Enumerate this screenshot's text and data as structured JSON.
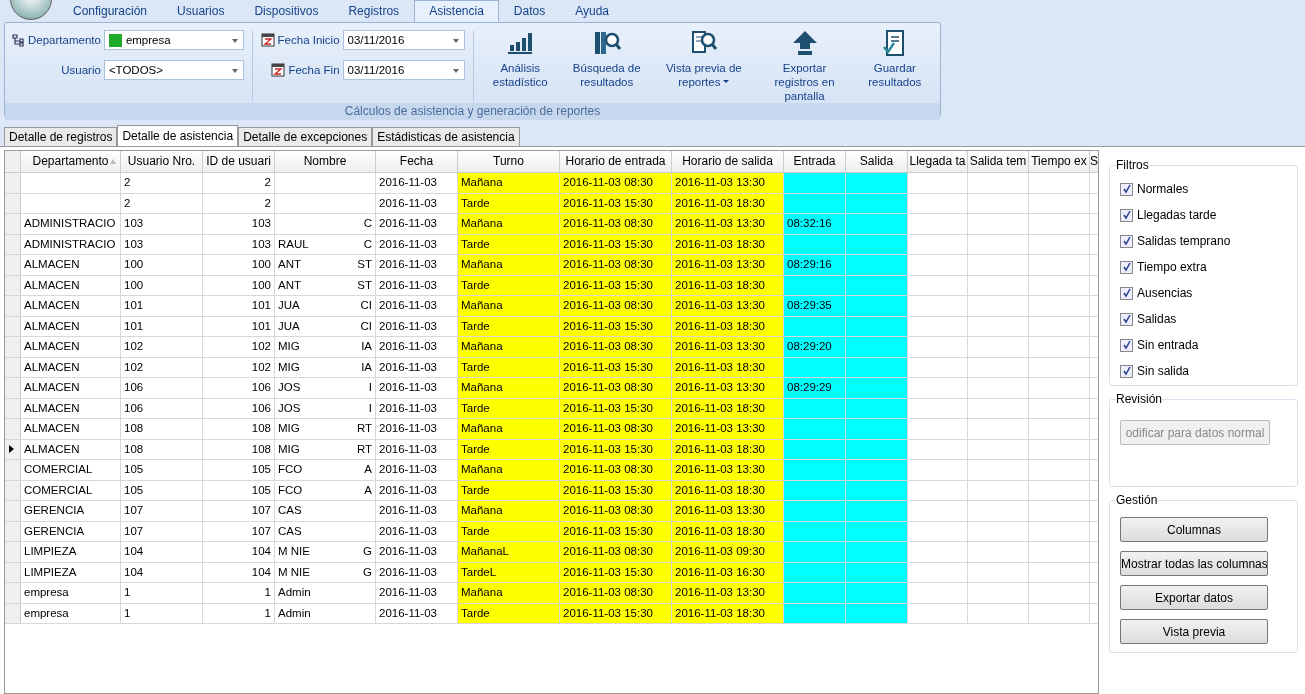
{
  "menu_tabs": [
    {
      "label": "Configuración",
      "selected": false
    },
    {
      "label": "Usuarios",
      "selected": false
    },
    {
      "label": "Dispositivos",
      "selected": false
    },
    {
      "label": "Registros",
      "selected": false
    },
    {
      "label": "Asistencia",
      "selected": true
    },
    {
      "label": "Datos",
      "selected": false
    },
    {
      "label": "Ayuda",
      "selected": false
    }
  ],
  "filters": {
    "departamento": {
      "label": "Departamento",
      "value": "empresa",
      "color": "#1faa2a"
    },
    "usuario": {
      "label": "Usuario",
      "value": "<TODOS>"
    },
    "fecha_inicio": {
      "label": "Fecha Inicio",
      "value": "03/11/2016"
    },
    "fecha_fin": {
      "label": "Fecha Fin",
      "value": "03/11/2016"
    }
  },
  "ribbon_buttons": [
    {
      "kind": "stats",
      "label": "Análisis estadístico",
      "dropdown": false
    },
    {
      "kind": "search",
      "label": "Búsqueda de resultados",
      "dropdown": false
    },
    {
      "kind": "preview",
      "label": "Vista previa de reportes",
      "dropdown": true
    },
    {
      "kind": "export",
      "label": "Exportar registros en pantalla",
      "dropdown": false
    },
    {
      "kind": "save",
      "label": "Guardar resultados",
      "dropdown": false
    }
  ],
  "ribbon_group": "Cálculos de asistencia y generación de reportes",
  "view_tabs": [
    {
      "label": "Detalle de registros",
      "selected": false
    },
    {
      "label": "Detalle de asistencia",
      "selected": true
    },
    {
      "label": "Detalle de excepciones",
      "selected": false
    },
    {
      "label": "Estádisticas de asistencia",
      "selected": false
    }
  ],
  "table": {
    "columns": [
      {
        "label": "Departamento",
        "sorted": true
      },
      {
        "label": "Usuario Nro.",
        "sorted": false
      },
      {
        "label": "ID de usuari",
        "sorted": false
      },
      {
        "label": "Nombre",
        "sorted": false
      },
      {
        "label": "Fecha",
        "sorted": false
      },
      {
        "label": "Turno",
        "sorted": false,
        "color": "#ffff00"
      },
      {
        "label": "Horario de entrada",
        "sorted": false,
        "color": "#ffff00"
      },
      {
        "label": "Horario de salida",
        "sorted": false,
        "color": "#ffff00"
      },
      {
        "label": "Entrada",
        "sorted": false,
        "color": "#00ffff"
      },
      {
        "label": "Salida",
        "sorted": false,
        "color": "#00ffff"
      },
      {
        "label": "Llegada ta",
        "sorted": false
      },
      {
        "label": "Salida tem",
        "sorted": false
      },
      {
        "label": "Tiempo ex",
        "sorted": false
      },
      {
        "label": "S",
        "sorted": false
      }
    ],
    "rows": [
      {
        "current": false,
        "departamento": null,
        "usuario_nro": "2",
        "id": "2",
        "nombre": null,
        "nombre_end": null,
        "fecha": "2016-11-03",
        "turno": "Mañana",
        "horario_entrada": "2016-11-03 08:30",
        "horario_salida": "2016-11-03 13:30",
        "entrada": null
      },
      {
        "current": false,
        "departamento": null,
        "usuario_nro": "2",
        "id": "2",
        "nombre": null,
        "nombre_end": null,
        "fecha": "2016-11-03",
        "turno": "Tarde",
        "horario_entrada": "2016-11-03 15:30",
        "horario_salida": "2016-11-03 18:30",
        "entrada": null
      },
      {
        "current": false,
        "departamento": "ADMINISTRACIO",
        "usuario_nro": "103",
        "id": "103",
        "nombre": null,
        "nombre_end": "C",
        "fecha": "2016-11-03",
        "turno": "Mañana",
        "horario_entrada": "2016-11-03 08:30",
        "horario_salida": "2016-11-03 13:30",
        "entrada": "08:32:16"
      },
      {
        "current": false,
        "departamento": "ADMINISTRACIO",
        "usuario_nro": "103",
        "id": "103",
        "nombre": "RAUL",
        "nombre_end": "C",
        "fecha": "2016-11-03",
        "turno": "Tarde",
        "horario_entrada": "2016-11-03 15:30",
        "horario_salida": "2016-11-03 18:30",
        "entrada": null
      },
      {
        "current": false,
        "departamento": "ALMACEN",
        "usuario_nro": "100",
        "id": "100",
        "nombre": "ANT",
        "nombre_end": "ST",
        "fecha": "2016-11-03",
        "turno": "Mañana",
        "horario_entrada": "2016-11-03 08:30",
        "horario_salida": "2016-11-03 13:30",
        "entrada": "08:29:16"
      },
      {
        "current": false,
        "departamento": "ALMACEN",
        "usuario_nro": "100",
        "id": "100",
        "nombre": "ANT",
        "nombre_end": "ST",
        "fecha": "2016-11-03",
        "turno": "Tarde",
        "horario_entrada": "2016-11-03 15:30",
        "horario_salida": "2016-11-03 18:30",
        "entrada": null
      },
      {
        "current": false,
        "departamento": "ALMACEN",
        "usuario_nro": "101",
        "id": "101",
        "nombre": "JUA",
        "nombre_end": "CI",
        "fecha": "2016-11-03",
        "turno": "Mañana",
        "horario_entrada": "2016-11-03 08:30",
        "horario_salida": "2016-11-03 13:30",
        "entrada": "08:29:35"
      },
      {
        "current": false,
        "departamento": "ALMACEN",
        "usuario_nro": "101",
        "id": "101",
        "nombre": "JUA",
        "nombre_end": "CI",
        "fecha": "2016-11-03",
        "turno": "Tarde",
        "horario_entrada": "2016-11-03 15:30",
        "horario_salida": "2016-11-03 18:30",
        "entrada": null
      },
      {
        "current": false,
        "departamento": "ALMACEN",
        "usuario_nro": "102",
        "id": "102",
        "nombre": "MIG",
        "nombre_end": "IA",
        "fecha": "2016-11-03",
        "turno": "Mañana",
        "horario_entrada": "2016-11-03 08:30",
        "horario_salida": "2016-11-03 13:30",
        "entrada": "08:29:20"
      },
      {
        "current": false,
        "departamento": "ALMACEN",
        "usuario_nro": "102",
        "id": "102",
        "nombre": "MIG",
        "nombre_end": "IA",
        "fecha": "2016-11-03",
        "turno": "Tarde",
        "horario_entrada": "2016-11-03 15:30",
        "horario_salida": "2016-11-03 18:30",
        "entrada": null
      },
      {
        "current": false,
        "departamento": "ALMACEN",
        "usuario_nro": "106",
        "id": "106",
        "nombre": "JOS",
        "nombre_end": "I",
        "fecha": "2016-11-03",
        "turno": "Mañana",
        "horario_entrada": "2016-11-03 08:30",
        "horario_salida": "2016-11-03 13:30",
        "entrada": "08:29:29"
      },
      {
        "current": false,
        "departamento": "ALMACEN",
        "usuario_nro": "106",
        "id": "106",
        "nombre": "JOS",
        "nombre_end": "I",
        "fecha": "2016-11-03",
        "turno": "Tarde",
        "horario_entrada": "2016-11-03 15:30",
        "horario_salida": "2016-11-03 18:30",
        "entrada": null
      },
      {
        "current": false,
        "departamento": "ALMACEN",
        "usuario_nro": "108",
        "id": "108",
        "nombre": "MIG",
        "nombre_end": "RT",
        "fecha": "2016-11-03",
        "turno": "Mañana",
        "horario_entrada": "2016-11-03 08:30",
        "horario_salida": "2016-11-03 13:30",
        "entrada": null
      },
      {
        "current": true,
        "departamento": "ALMACEN",
        "usuario_nro": "108",
        "id": "108",
        "nombre": "MIG",
        "nombre_end": "RT",
        "fecha": "2016-11-03",
        "turno": "Tarde",
        "horario_entrada": "2016-11-03 15:30",
        "horario_salida": "2016-11-03 18:30",
        "entrada": null
      },
      {
        "current": false,
        "departamento": "COMERCIAL",
        "usuario_nro": "105",
        "id": "105",
        "nombre": "FCO",
        "nombre_end": "A",
        "fecha": "2016-11-03",
        "turno": "Mañana",
        "horario_entrada": "2016-11-03 08:30",
        "horario_salida": "2016-11-03 13:30",
        "entrada": null
      },
      {
        "current": false,
        "departamento": "COMERCIAL",
        "usuario_nro": "105",
        "id": "105",
        "nombre": "FCO",
        "nombre_end": "A",
        "fecha": "2016-11-03",
        "turno": "Tarde",
        "horario_entrada": "2016-11-03 15:30",
        "horario_salida": "2016-11-03 18:30",
        "entrada": null
      },
      {
        "current": false,
        "departamento": "GERENCIA",
        "usuario_nro": "107",
        "id": "107",
        "nombre": "CAS",
        "nombre_end": null,
        "fecha": "2016-11-03",
        "turno": "Mañana",
        "horario_entrada": "2016-11-03 08:30",
        "horario_salida": "2016-11-03 13:30",
        "entrada": null
      },
      {
        "current": false,
        "departamento": "GERENCIA",
        "usuario_nro": "107",
        "id": "107",
        "nombre": "CAS",
        "nombre_end": null,
        "fecha": "2016-11-03",
        "turno": "Tarde",
        "horario_entrada": "2016-11-03 15:30",
        "horario_salida": "2016-11-03 18:30",
        "entrada": null
      },
      {
        "current": false,
        "departamento": "LIMPIEZA",
        "usuario_nro": "104",
        "id": "104",
        "nombre": "M NIE",
        "nombre_end": "G",
        "fecha": "2016-11-03",
        "turno": "MañanaL",
        "horario_entrada": "2016-11-03 08:30",
        "horario_salida": "2016-11-03 09:30",
        "entrada": null
      },
      {
        "current": false,
        "departamento": "LIMPIEZA",
        "usuario_nro": "104",
        "id": "104",
        "nombre": "M NIE",
        "nombre_end": "G",
        "fecha": "2016-11-03",
        "turno": "TardeL",
        "horario_entrada": "2016-11-03 15:30",
        "horario_salida": "2016-11-03 16:30",
        "entrada": null
      },
      {
        "current": false,
        "departamento": "empresa",
        "usuario_nro": "1",
        "id": "1",
        "nombre": "Admin",
        "nombre_end": null,
        "fecha": "2016-11-03",
        "turno": "Mañana",
        "horario_entrada": "2016-11-03 08:30",
        "horario_salida": "2016-11-03 13:30",
        "entrada": null
      },
      {
        "current": false,
        "departamento": "empresa",
        "usuario_nro": "1",
        "id": "1",
        "nombre": "Admin",
        "nombre_end": null,
        "fecha": "2016-11-03",
        "turno": "Tarde",
        "horario_entrada": "2016-11-03 15:30",
        "horario_salida": "2016-11-03 18:30",
        "entrada": null
      }
    ]
  },
  "panel": {
    "filtros": {
      "title": "Filtros",
      "items": [
        {
          "label": "Normales",
          "checked": true
        },
        {
          "label": "Llegadas tarde",
          "checked": true
        },
        {
          "label": "Salidas temprano",
          "checked": true
        },
        {
          "label": "Tiempo extra",
          "checked": true
        },
        {
          "label": "Ausencias",
          "checked": true
        },
        {
          "label": "Salidas",
          "checked": true
        },
        {
          "label": "Sin entrada",
          "checked": true
        },
        {
          "label": "Sin salida",
          "checked": true
        }
      ]
    },
    "revision": {
      "title": "Revisión",
      "button": {
        "label": "odificar para datos normal",
        "disabled": true
      }
    },
    "gestion": {
      "title": "Gestión",
      "buttons": [
        "Columnas",
        "Mostrar todas las columnas",
        "Exportar datos",
        "Vista previa"
      ]
    }
  }
}
